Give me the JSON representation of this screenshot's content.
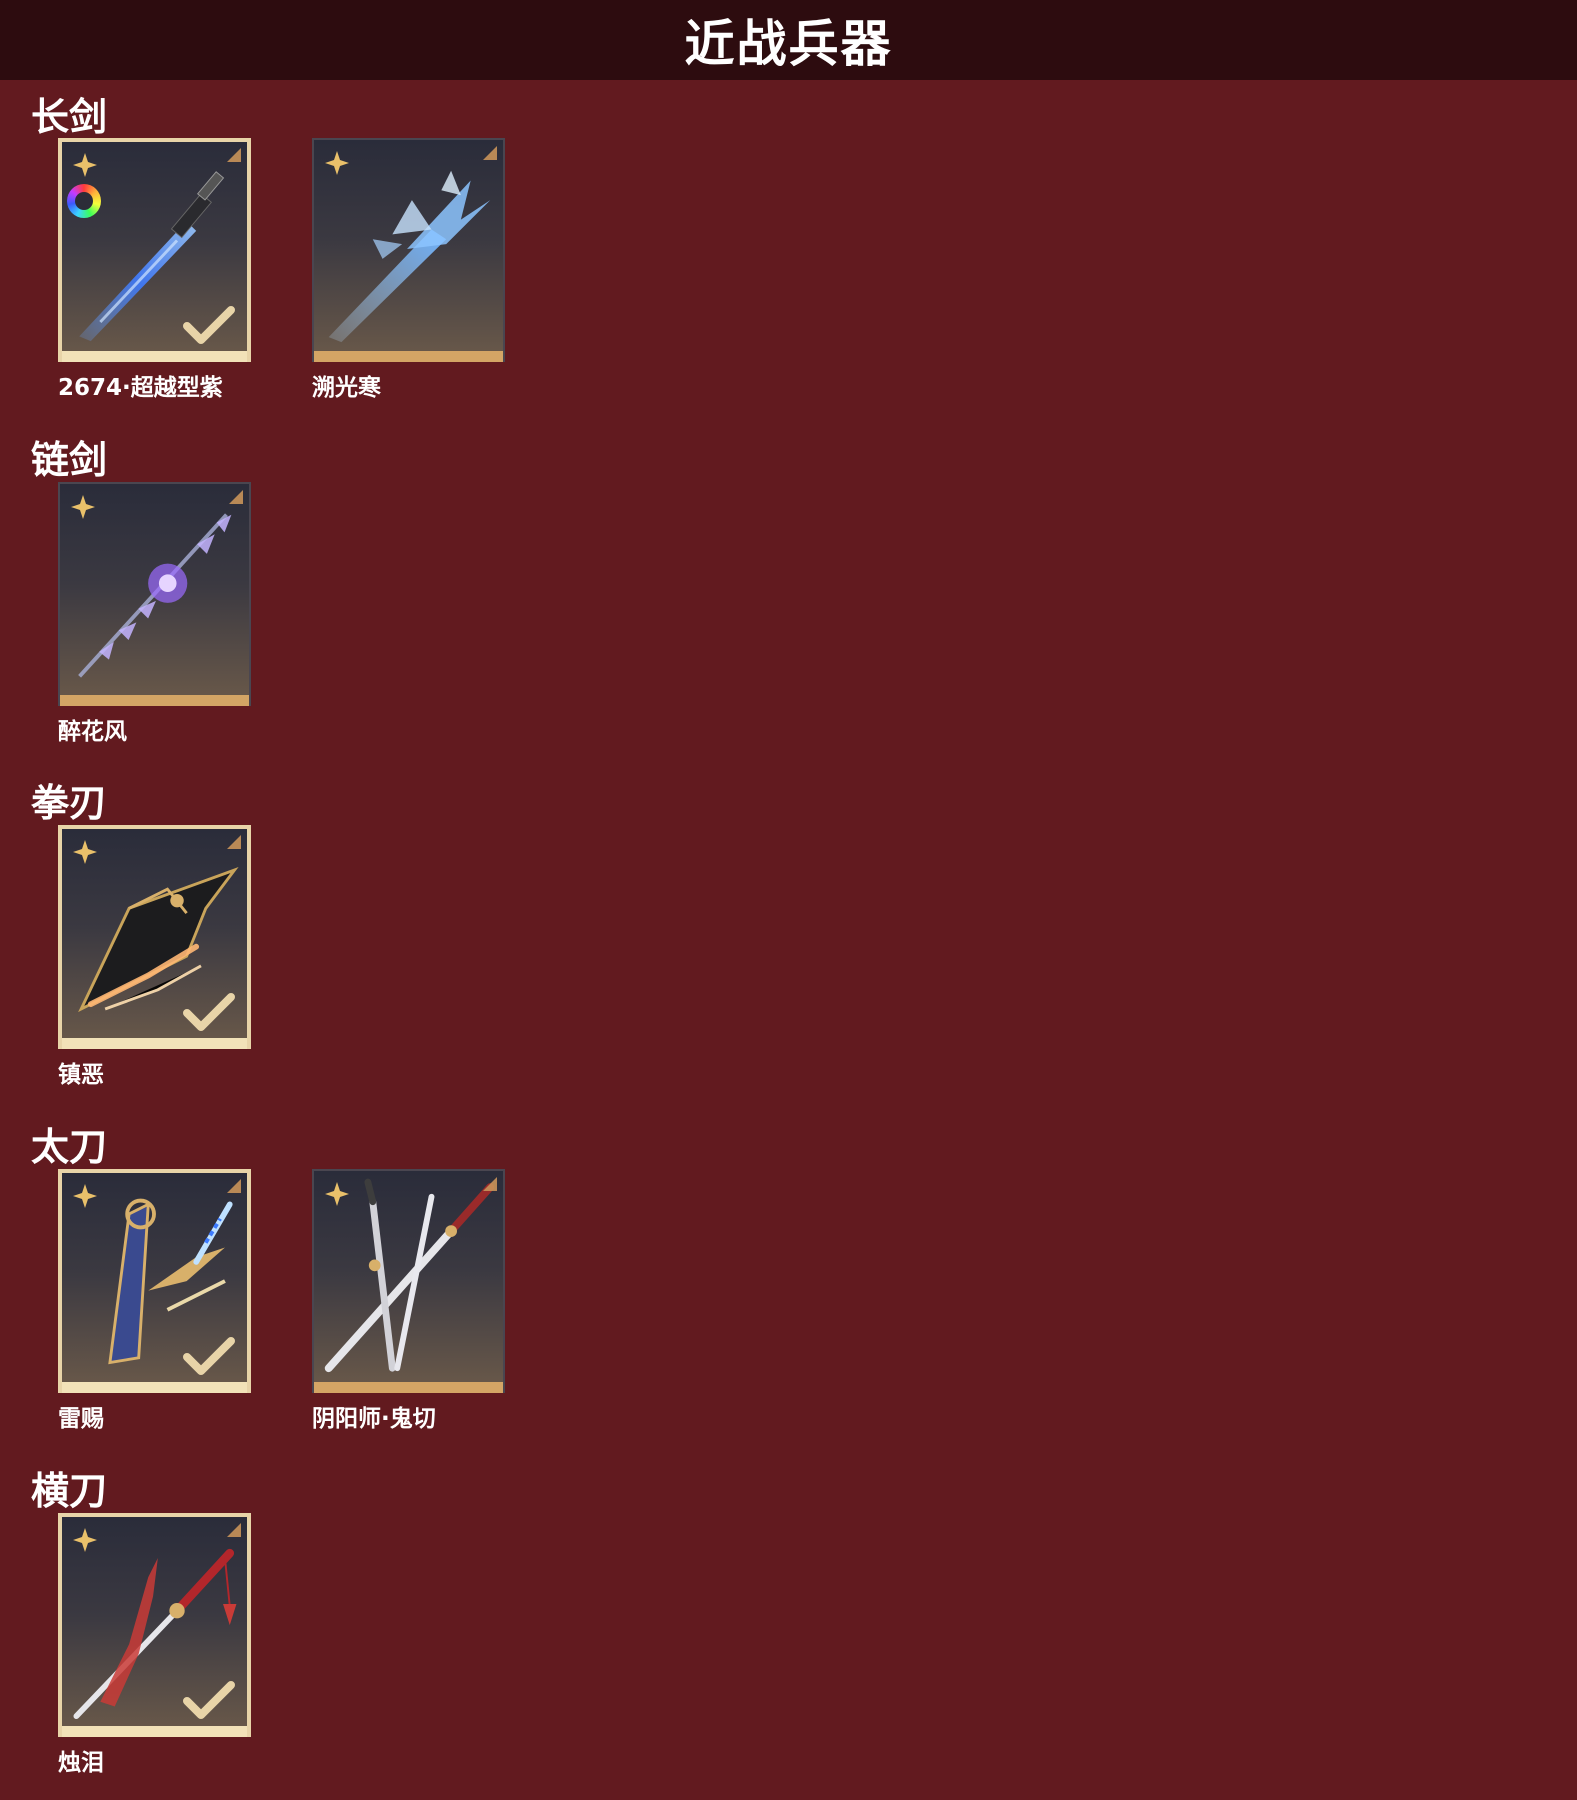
{
  "header": {
    "title": "近战兵器"
  },
  "sections": [
    {
      "title": "长剑",
      "items": [
        {
          "name": "2674·超越型紫",
          "selected": true,
          "has_palette": true,
          "art": "blue-blade-icon"
        },
        {
          "name": "溯光寒",
          "selected": false,
          "has_palette": false,
          "art": "ice-crystal-sword-icon"
        }
      ]
    },
    {
      "title": "链剑",
      "items": [
        {
          "name": "醉花风",
          "selected": false,
          "has_palette": false,
          "art": "purple-chain-sword-icon"
        }
      ]
    },
    {
      "title": "拳刃",
      "items": [
        {
          "name": "镇恶",
          "selected": true,
          "has_palette": false,
          "art": "gold-fist-blade-icon"
        }
      ]
    },
    {
      "title": "太刀",
      "items": [
        {
          "name": "雷赐",
          "selected": true,
          "has_palette": false,
          "art": "gold-blue-katana-icon"
        },
        {
          "name": "阴阳师·鬼切",
          "selected": false,
          "has_palette": false,
          "art": "twin-katana-icon"
        }
      ]
    },
    {
      "title": "横刀",
      "items": [
        {
          "name": "烛泪",
          "selected": true,
          "has_palette": false,
          "art": "red-sabre-icon"
        }
      ]
    }
  ],
  "colors": {
    "background": "#621a1f",
    "header_background": "#2d0c0f",
    "selected_border": "#e8d4a8",
    "unselected_bar": "#d4a565"
  }
}
